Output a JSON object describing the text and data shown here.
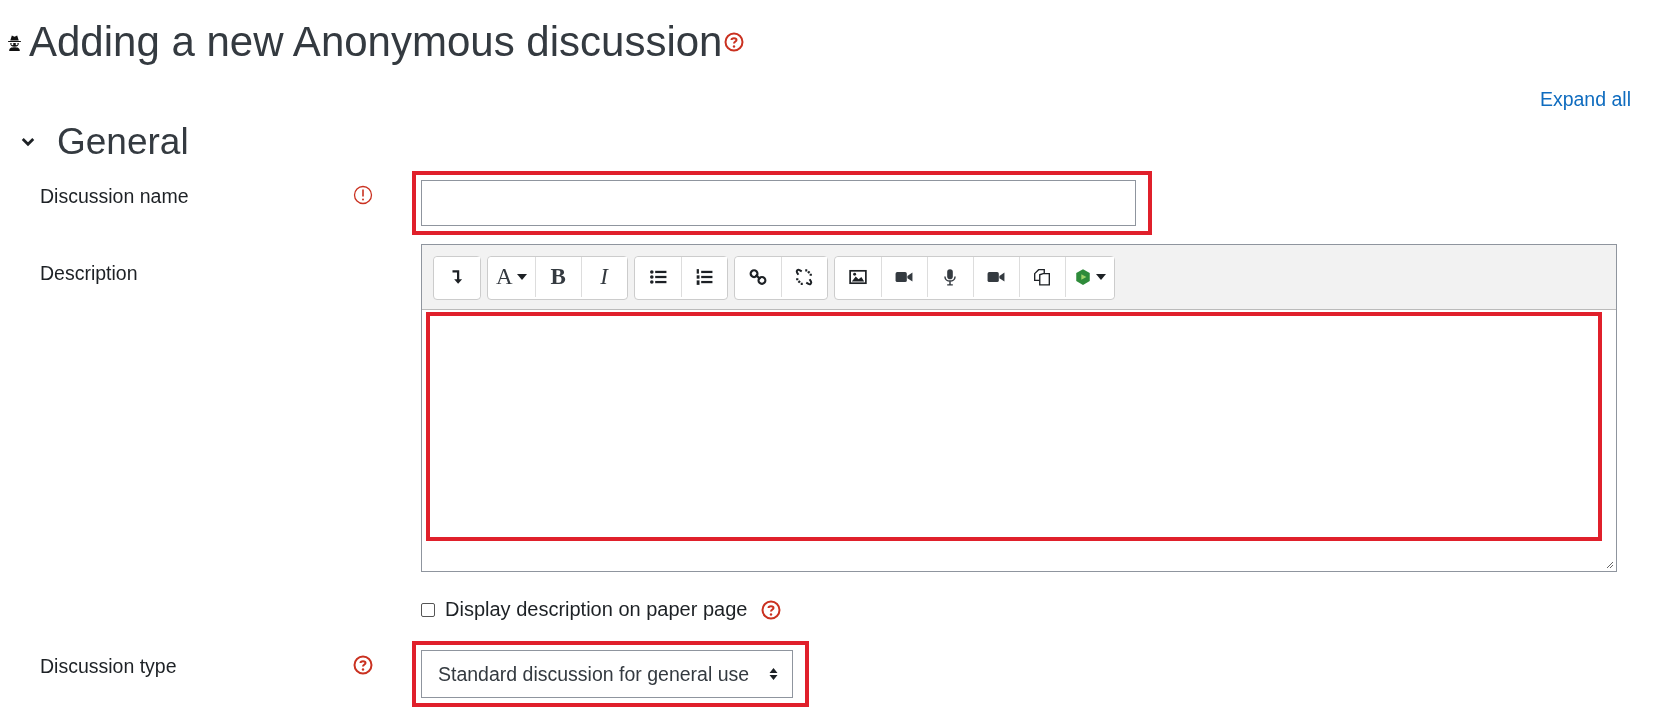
{
  "page_title": "Adding a new Anonymous discussion",
  "expand_all": "Expand all",
  "section": {
    "title": "General",
    "expanded": true
  },
  "fields": [
    {
      "kind": "text",
      "label": "Discussion name",
      "required": true,
      "highlighted": true
    },
    {
      "kind": "editor",
      "label": "Description",
      "highlighted": true,
      "toolbar": [
        [
          {
            "kind": "toggle"
          }
        ],
        [
          {
            "kind": "font",
            "label": "A"
          },
          {
            "kind": "bold",
            "label": "B"
          },
          {
            "kind": "italic",
            "label": "I"
          }
        ],
        [
          {
            "kind": "bullets"
          },
          {
            "kind": "numbers"
          }
        ],
        [
          {
            "kind": "link"
          },
          {
            "kind": "unlink"
          }
        ],
        [
          {
            "kind": "image"
          },
          {
            "kind": "video"
          },
          {
            "kind": "mic"
          },
          {
            "kind": "video"
          },
          {
            "kind": "copy"
          },
          {
            "kind": "media"
          }
        ]
      ]
    },
    {
      "kind": "checkbox",
      "label": "Display description on paper page",
      "checked": false,
      "help": true
    },
    {
      "kind": "select",
      "label": "Discussion type",
      "value": "Standard discussion for general use",
      "help": true,
      "highlighted": true
    }
  ]
}
